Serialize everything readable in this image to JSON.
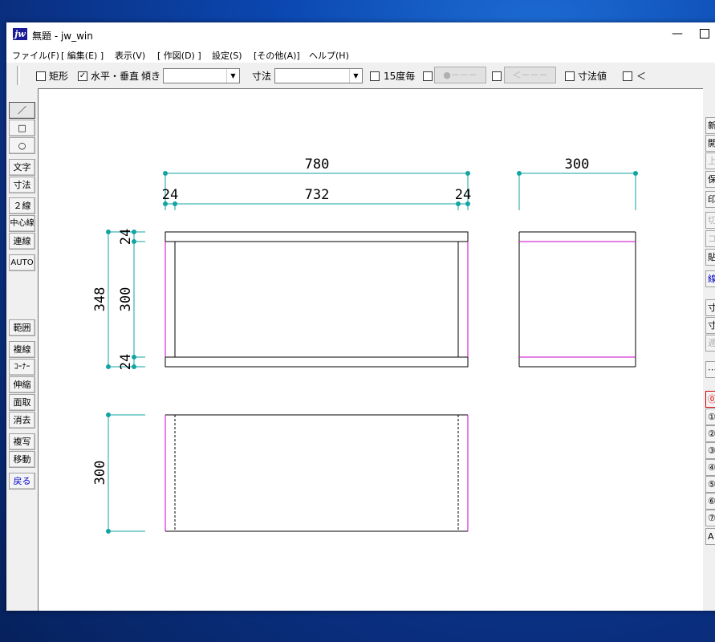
{
  "window": {
    "title": "無題 - jw_win",
    "app_icon": "jw",
    "minimize": "—"
  },
  "menu": {
    "items": [
      "ファイル(F)",
      "[ 編集(E) ]",
      "表示(V)",
      "[ 作図(D) ]",
      "設定(S)",
      "[その他(A)]",
      "ヘルプ(H)"
    ]
  },
  "toolbar": {
    "rect_label": "矩形",
    "rect_checked": false,
    "hv_label": "水平・垂直",
    "hv_checked": true,
    "angle_label": "傾き",
    "angle_value": "",
    "dim_label": "寸法",
    "dim_value": "",
    "deg15_label": "15度毎",
    "deg15_checked": false,
    "dot_button": "●－－－",
    "arrow_button": "＜－－－",
    "dimval_label": "寸法値",
    "dimval_checked": false,
    "last_label": "＜"
  },
  "left_tools": {
    "line": "／",
    "rect": "□",
    "circle": "○",
    "text": "文字",
    "dim": "寸法",
    "double_line": "２線",
    "center_line": "中心線",
    "connect": "連線",
    "auto": "AUTO",
    "range": "範囲",
    "multi_line": "複線",
    "corner": "ｺｰﾅｰ",
    "stretch": "伸縮",
    "chamfer": "面取",
    "erase": "消去",
    "copy": "複写",
    "move": "移動",
    "undo": "戻る"
  },
  "right_tools": {
    "new": "新",
    "open": "開",
    "overwrite": "上",
    "save": "保",
    "print": "印",
    "cut": "切",
    "copy": "コ",
    "paste": "貼",
    "line_type": "線",
    "dim1": "寸",
    "dim2": "寸",
    "dim3": "逓",
    "dots": "⋯",
    "layers": [
      "0",
      "1",
      "2",
      "3",
      "4",
      "5",
      "6",
      "7"
    ],
    "all": "A"
  },
  "drawing": {
    "dim_780": "780",
    "dim_300_top": "300",
    "dim_24_left": "24",
    "dim_732": "732",
    "dim_24_right": "24",
    "dim_348": "348",
    "dim_300_vert": "300",
    "dim_24_top_side": "24",
    "dim_24_bottom_side": "24",
    "dim_300_bottom": "300",
    "colors": {
      "dimension": "#12a3a3",
      "magenta": "#c800c8",
      "outline": "#000000"
    }
  }
}
